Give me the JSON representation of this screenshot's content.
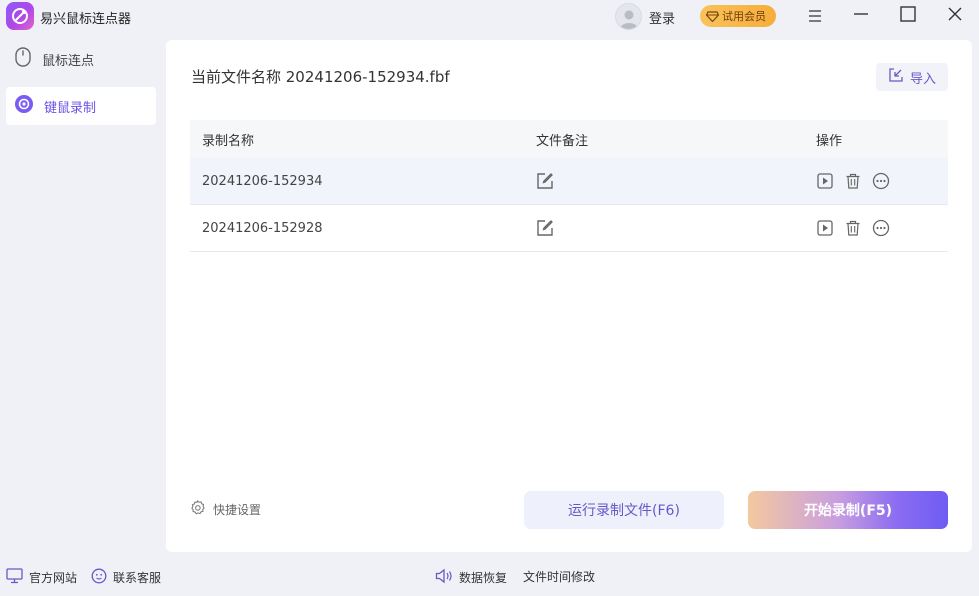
{
  "app": {
    "title": "易兴鼠标连点器"
  },
  "header": {
    "login_label": "登录",
    "vip_label": "试用会员"
  },
  "sidebar": {
    "items": [
      {
        "label": "鼠标连点",
        "icon": "mouse-icon",
        "active": false
      },
      {
        "label": "键鼠录制",
        "icon": "record-icon",
        "active": true
      }
    ]
  },
  "main": {
    "file_title": "当前文件名称 20241206-152934.fbf",
    "import_label": "导入",
    "table": {
      "columns": [
        "录制名称",
        "文件备注",
        "操作"
      ],
      "rows": [
        {
          "name": "20241206-152934"
        },
        {
          "name": "20241206-152928"
        }
      ]
    },
    "shortcut_label": "快捷设置",
    "run_button": "运行录制文件(F6)",
    "start_button": "开始录制(F5)"
  },
  "footer": {
    "official_site": "官方网站",
    "support": "联系客服",
    "data_recovery": "数据恢复",
    "file_time_edit": "文件时间修改"
  },
  "colors": {
    "accent": "#6b52e8",
    "vip": "#f7b648",
    "background": "#eff1f7"
  }
}
